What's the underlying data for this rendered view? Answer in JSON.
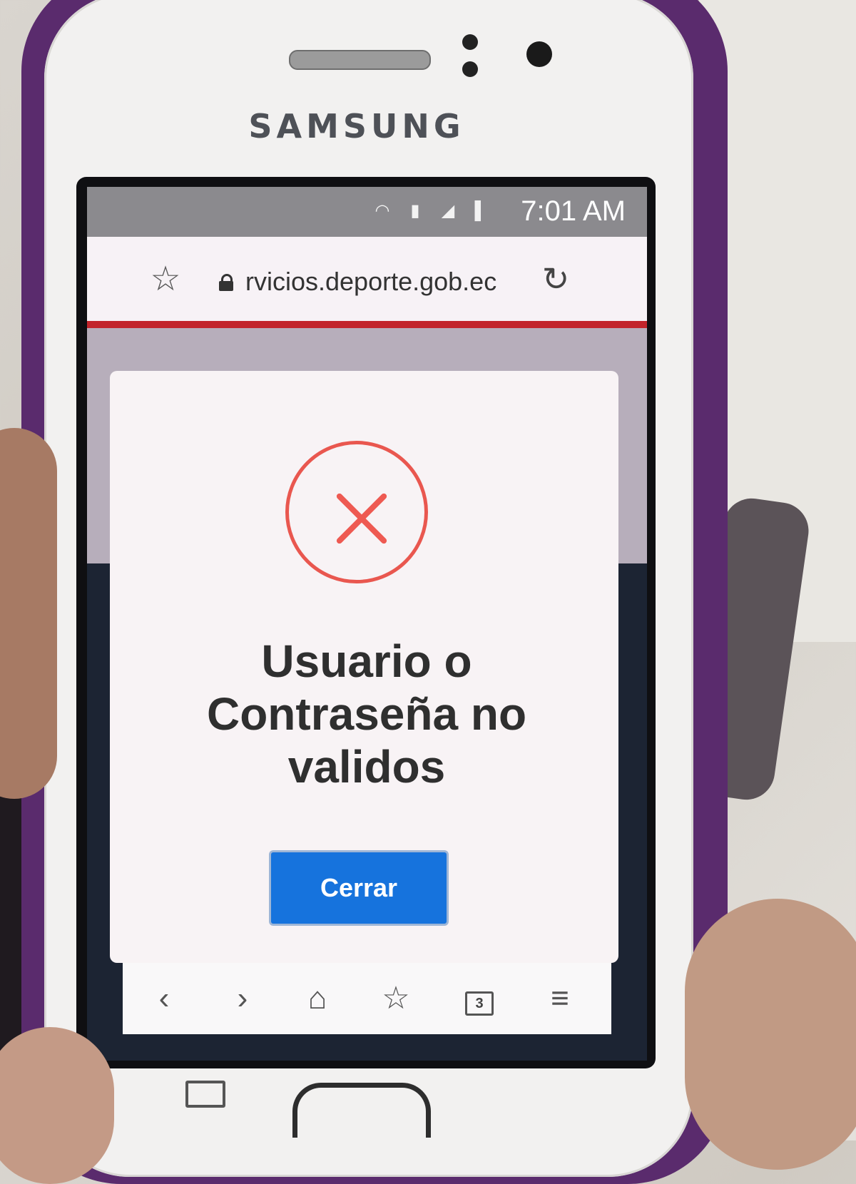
{
  "device": {
    "brand": "SAMSUNG"
  },
  "status_bar": {
    "time": "7:01 AM",
    "icons": [
      "wifi-icon",
      "sim-icon",
      "signal-icon",
      "battery-icon"
    ]
  },
  "browser": {
    "url": "rvicios.deporte.gob.ec",
    "icons": {
      "bookmark": "star-icon",
      "secure": "lock-icon",
      "reload": "reload-icon"
    },
    "progress_color": "#c2242b"
  },
  "dialog": {
    "icon": "error-x-icon",
    "icon_color": "#e9574f",
    "title": "Usuario o Contraseña no validos",
    "button_label": "Cerrar",
    "button_color": "#1673dd"
  },
  "bottom_nav": {
    "items": [
      "back-icon",
      "forward-icon",
      "home-icon",
      "bookmarks-icon",
      "tabs-icon",
      "menu-icon"
    ],
    "tab_count": "3"
  }
}
